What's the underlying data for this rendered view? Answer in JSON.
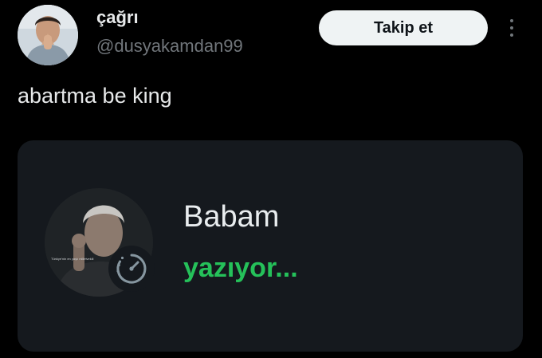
{
  "author": {
    "display_name": "çağrı",
    "handle": "@dusyakamdan99"
  },
  "follow_button": {
    "label": "Takip et"
  },
  "tweet": {
    "text": "abartma be king"
  },
  "media": {
    "contact_name": "Babam",
    "status": "yazıyor...",
    "photo_caption": "Türkiye'nin en yaşlı milletvekili",
    "status_color": "#25c15a"
  },
  "icons": {
    "more": "more-vertical-icon",
    "timer": "disappearing-timer-icon"
  },
  "colors": {
    "background": "#000000",
    "text_primary": "#e7e9ea",
    "text_secondary": "#71767b",
    "button_bg": "#eff3f4",
    "card_bg": "#15191e",
    "accent_green": "#25c15a"
  }
}
